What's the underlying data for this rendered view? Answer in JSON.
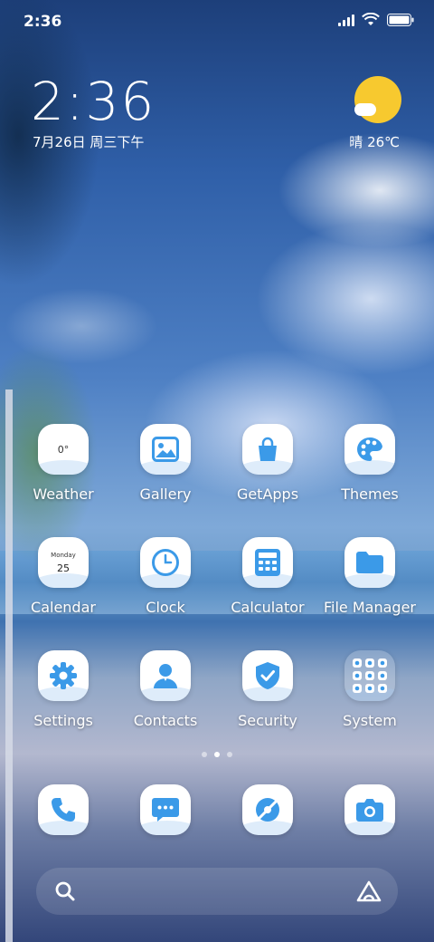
{
  "status_bar": {
    "time": "2:36"
  },
  "clock_widget": {
    "time": "2:36",
    "date": "7月26日 周三下午"
  },
  "weather_widget": {
    "condition_temp": "晴 26℃"
  },
  "apps": [
    {
      "label": "Weather",
      "icon": "weather-icon",
      "badge": "0°"
    },
    {
      "label": "Gallery",
      "icon": "gallery-icon"
    },
    {
      "label": "GetApps",
      "icon": "shopping-bag-icon"
    },
    {
      "label": "Themes",
      "icon": "palette-icon"
    },
    {
      "label": "Calendar",
      "icon": "calendar-icon",
      "day_name": "Monday",
      "day_num": "25"
    },
    {
      "label": "Clock",
      "icon": "clock-icon"
    },
    {
      "label": "Calculator",
      "icon": "calculator-icon"
    },
    {
      "label": "File Manager",
      "icon": "folder-icon"
    },
    {
      "label": "Settings",
      "icon": "gear-icon"
    },
    {
      "label": "Contacts",
      "icon": "contact-icon"
    },
    {
      "label": "Security",
      "icon": "shield-icon"
    },
    {
      "label": "System",
      "icon": "folder-grid-icon"
    }
  ],
  "dock": [
    {
      "icon": "phone-icon"
    },
    {
      "icon": "message-icon"
    },
    {
      "icon": "browser-icon"
    },
    {
      "icon": "camera-icon"
    }
  ],
  "colors": {
    "icon_accent": "#3b9ae8",
    "sun": "#f7c92f"
  }
}
